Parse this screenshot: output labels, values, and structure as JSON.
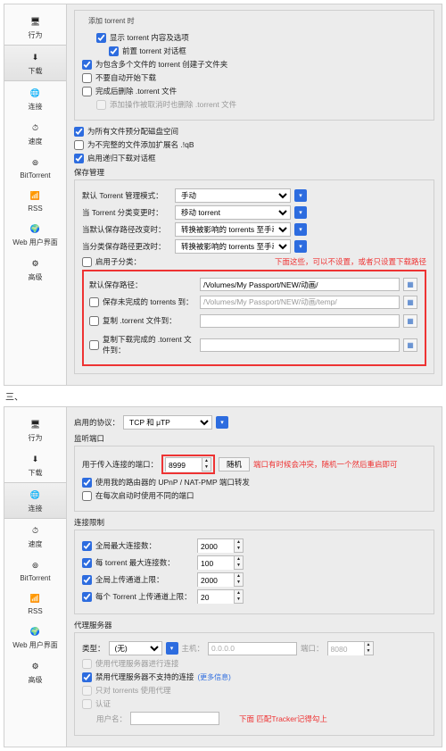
{
  "sidebar": {
    "items": [
      {
        "label": "行为"
      },
      {
        "label": "下载"
      },
      {
        "label": "连接"
      },
      {
        "label": "速度"
      },
      {
        "label": "BitTorrent"
      },
      {
        "label": "RSS"
      },
      {
        "label": "Web 用户界面"
      },
      {
        "label": "高级"
      }
    ]
  },
  "p1": {
    "add_torrent_title": "添加 torrent 时",
    "show_content": "显示 torrent 内容及选项",
    "front_dialog": "前置 torrent 对话框",
    "multi_folder": "为包含多个文件的 torrent 创建子文件夹",
    "no_auto_start": "不要自动开始下载",
    "del_after": "完成后删除 .torrent 文件",
    "del_cancel": "添加操作被取消时也删除 .torrent 文件",
    "prealloc": "为所有文件预分配磁盘空间",
    "append_qb": "为不完整的文件添加扩展名 .!qB",
    "recursive": "启用递归下载对话框",
    "save_mgmt": "保存管理",
    "mgmt_mode": "默认 Torrent 管理模式：",
    "mgmt_mode_val": "手动",
    "cat_change": "当 Torrent 分类变更时：",
    "cat_change_val": "移动 torrent",
    "savepath_change": "当默认保存路径改变时：",
    "savepath_change_val": "转换被影响的 torrents 至手动模式",
    "catpath_change": "当分类保存路径更改时：",
    "catpath_change_val": "转换被影响的 torrents 至手动模式",
    "use_cat": "启用子分类：",
    "note": "下面这些，可以不设置，或者只设置下载路径",
    "paths": {
      "default": "默认保存路径：",
      "default_val": "/Volumes/My Passport/NEW/动画/",
      "incomplete": "保存未完成的 torrents 到：",
      "incomplete_val": "/Volumes/My Passport/NEW/动画/temp/",
      "copy": "复制 .torrent 文件到：",
      "copy_val": "",
      "copy_done": "复制下载完成的 .torrent 文件到：",
      "copy_done_val": ""
    }
  },
  "separator": "三、",
  "p2": {
    "proto": "启用的协议：",
    "proto_val": "TCP 和 μTP",
    "listen_title": "监听端口",
    "incoming_port": "用于传入连接的端口：",
    "port_val": "8999",
    "random_btn": "随机",
    "port_note": "端口有时候会冲突，随机一个然后重启即可",
    "upnp": "使用我的路由器的 UPnP / NAT-PMP 端口转发",
    "diff_port": "在每次启动时使用不同的端口",
    "limits_title": "连接限制",
    "max_conn": "全局最大连接数：",
    "max_conn_val": "2000",
    "per_torrent": "每 torrent 最大连接数：",
    "per_torrent_val": "100",
    "max_up": "全局上传通道上限：",
    "max_up_val": "2000",
    "per_up": "每个 Torrent 上传通道上限：",
    "per_up_val": "20",
    "proxy_title": "代理服务器",
    "type": "类型：",
    "type_val": "(无)",
    "host": "主机：",
    "host_val": "0.0.0.0",
    "port": "端口：",
    "port_val2": "8080",
    "use_proxy_peer": "使用代理服务器进行连接",
    "disable_unsupported": "禁用代理服务器不支持的连接",
    "more_info": "(更多信息)",
    "torrents_only": "只对 torrents 使用代理",
    "auth": "认证",
    "user": "用户名：",
    "tracker_note": "下面 匹配Tracker记得勾上"
  }
}
